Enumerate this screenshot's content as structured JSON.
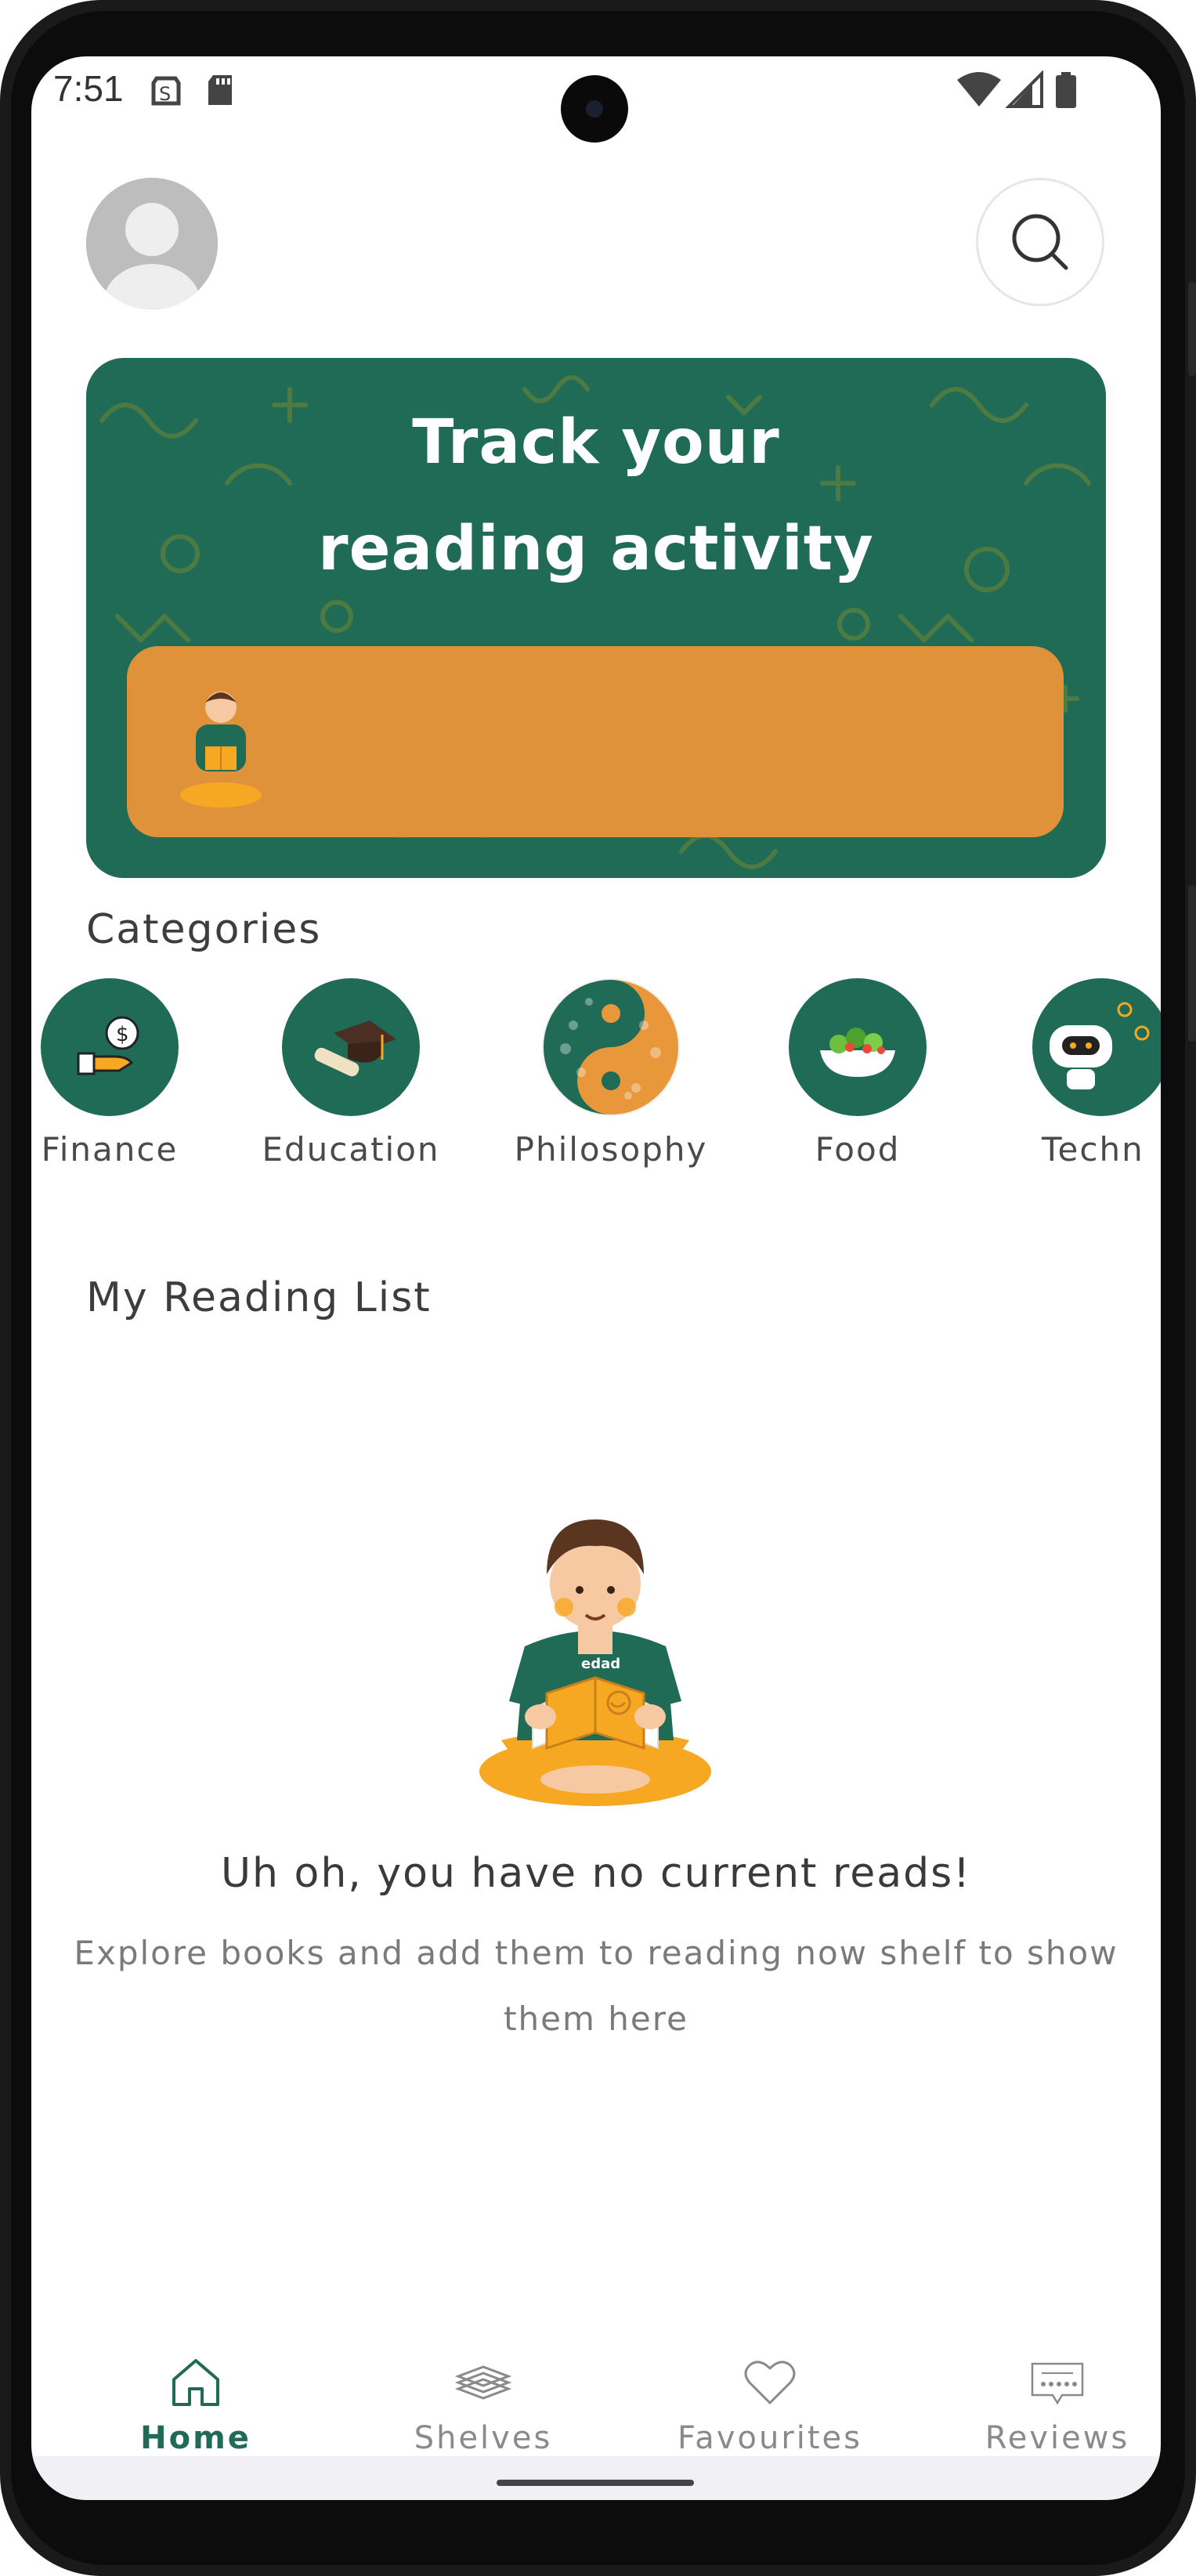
{
  "status_bar": {
    "time": "7:51"
  },
  "header": {
    "avatar_icon": "user-avatar-icon",
    "search_icon": "search-icon"
  },
  "banner": {
    "title_line1": "Track your",
    "title_line2": "reading activity"
  },
  "categories": {
    "title": "Categories",
    "items": [
      {
        "label": "Finance",
        "icon": "money-hand-icon"
      },
      {
        "label": "Education",
        "icon": "graduation-cap-icon"
      },
      {
        "label": "Philosophy",
        "icon": "yin-yang-icon"
      },
      {
        "label": "Food",
        "icon": "salad-bowl-icon"
      },
      {
        "label": "Techn",
        "icon": "robot-icon"
      }
    ]
  },
  "reading_list": {
    "title": "My Reading List",
    "empty_title": "Uh oh, you have no current reads!",
    "empty_subtitle": "Explore books and add them to reading now shelf to show them here",
    "illustration_badge": "edad"
  },
  "bottom_nav": {
    "items": [
      {
        "label": "Home",
        "icon": "home-icon",
        "active": true
      },
      {
        "label": "Shelves",
        "icon": "books-stack-icon",
        "active": false
      },
      {
        "label": "Favourites",
        "icon": "heart-icon",
        "active": false
      },
      {
        "label": "Reviews",
        "icon": "review-card-icon",
        "active": false
      }
    ]
  },
  "colors": {
    "primary_green": "#1f6b55",
    "banner_orange": "#e0923a",
    "text_dark": "#3d3d3d"
  }
}
